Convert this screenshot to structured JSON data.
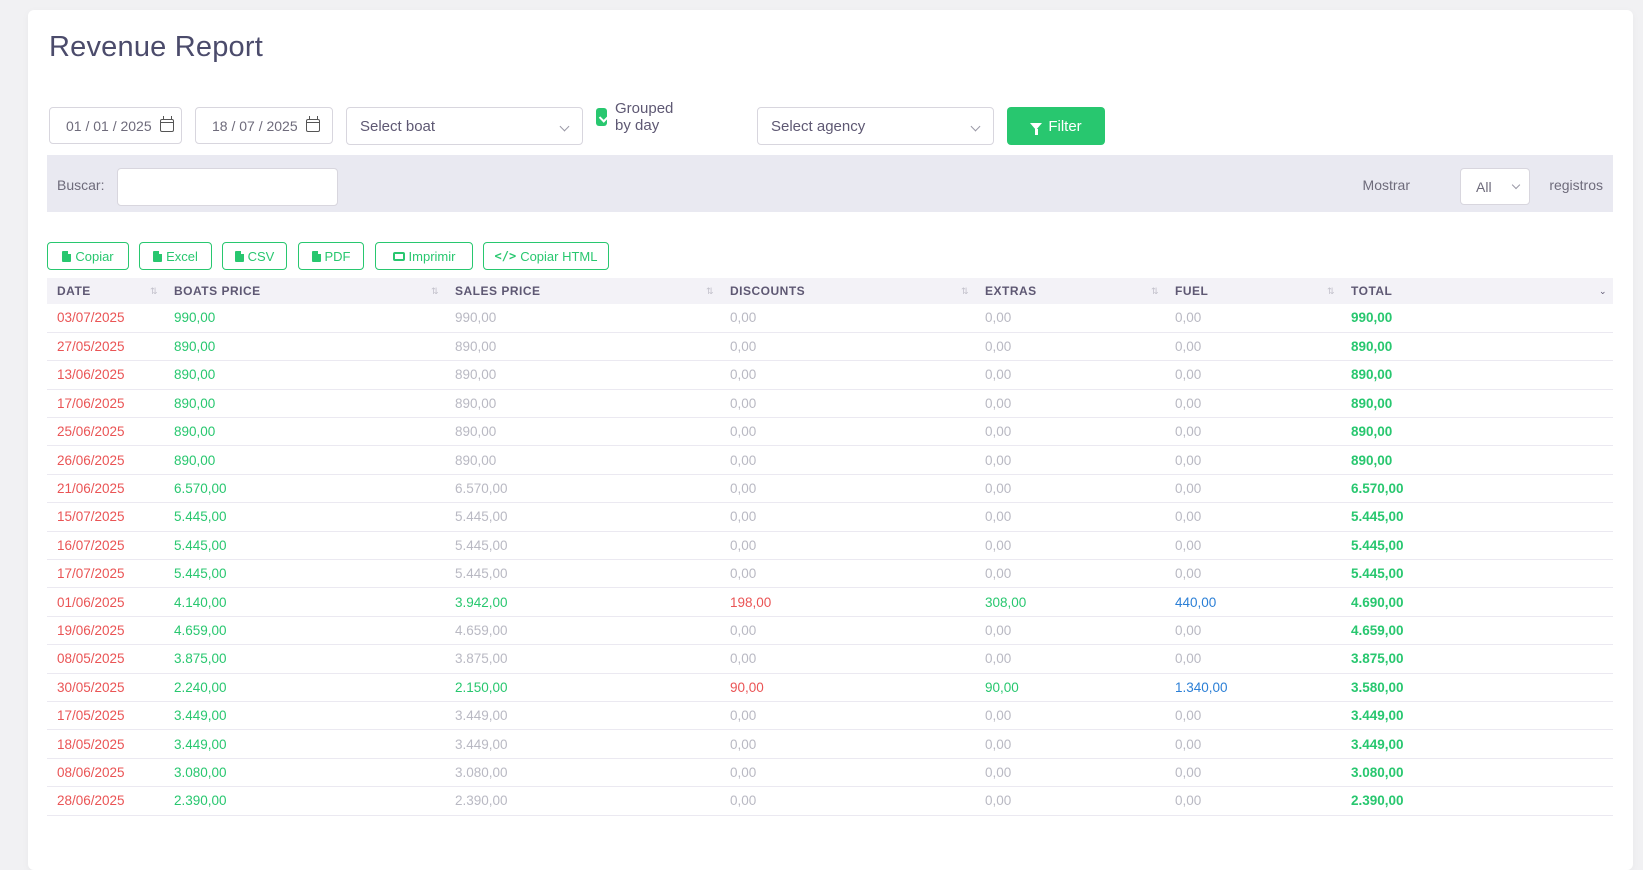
{
  "page": {
    "title": "Revenue Report"
  },
  "filters": {
    "date_from": "01 / 01 / 2025",
    "date_to": "18 / 07 / 2025",
    "boat_select": "Select boat",
    "grouped_label": "Grouped by day",
    "agency_select": "Select agency",
    "filter_button": "Filter"
  },
  "search": {
    "label": "Buscar:",
    "value": ""
  },
  "show": {
    "label": "Mostrar",
    "value": "All",
    "suffix": "registros"
  },
  "export_buttons": [
    "Copiar",
    "Excel",
    "CSV",
    "PDF",
    "Imprimir",
    "Copiar HTML"
  ],
  "table": {
    "headers": [
      "DATE",
      "BOATS PRICE",
      "SALES PRICE",
      "DISCOUNTS",
      "EXTRAS",
      "FUEL",
      "TOTAL"
    ],
    "rows": [
      [
        "03/07/2025",
        "990,00",
        "990,00",
        "0,00",
        "0,00",
        "0,00",
        "990,00"
      ],
      [
        "27/05/2025",
        "890,00",
        "890,00",
        "0,00",
        "0,00",
        "0,00",
        "890,00"
      ],
      [
        "13/06/2025",
        "890,00",
        "890,00",
        "0,00",
        "0,00",
        "0,00",
        "890,00"
      ],
      [
        "17/06/2025",
        "890,00",
        "890,00",
        "0,00",
        "0,00",
        "0,00",
        "890,00"
      ],
      [
        "25/06/2025",
        "890,00",
        "890,00",
        "0,00",
        "0,00",
        "0,00",
        "890,00"
      ],
      [
        "26/06/2025",
        "890,00",
        "890,00",
        "0,00",
        "0,00",
        "0,00",
        "890,00"
      ],
      [
        "21/06/2025",
        "6.570,00",
        "6.570,00",
        "0,00",
        "0,00",
        "0,00",
        "6.570,00"
      ],
      [
        "15/07/2025",
        "5.445,00",
        "5.445,00",
        "0,00",
        "0,00",
        "0,00",
        "5.445,00"
      ],
      [
        "16/07/2025",
        "5.445,00",
        "5.445,00",
        "0,00",
        "0,00",
        "0,00",
        "5.445,00"
      ],
      [
        "17/07/2025",
        "5.445,00",
        "5.445,00",
        "0,00",
        "0,00",
        "0,00",
        "5.445,00"
      ],
      [
        "01/06/2025",
        "4.140,00",
        "3.942,00",
        "198,00",
        "308,00",
        "440,00",
        "4.690,00"
      ],
      [
        "19/06/2025",
        "4.659,00",
        "4.659,00",
        "0,00",
        "0,00",
        "0,00",
        "4.659,00"
      ],
      [
        "08/05/2025",
        "3.875,00",
        "3.875,00",
        "0,00",
        "0,00",
        "0,00",
        "3.875,00"
      ],
      [
        "30/05/2025",
        "2.240,00",
        "2.150,00",
        "90,00",
        "90,00",
        "1.340,00",
        "3.580,00"
      ],
      [
        "17/05/2025",
        "3.449,00",
        "3.449,00",
        "0,00",
        "0,00",
        "0,00",
        "3.449,00"
      ],
      [
        "18/05/2025",
        "3.449,00",
        "3.449,00",
        "0,00",
        "0,00",
        "0,00",
        "3.449,00"
      ],
      [
        "08/06/2025",
        "3.080,00",
        "3.080,00",
        "0,00",
        "0,00",
        "0,00",
        "3.080,00"
      ],
      [
        "28/06/2025",
        "2.390,00",
        "2.390,00",
        "0,00",
        "0,00",
        "0,00",
        "2.390,00"
      ]
    ]
  },
  "colors": {
    "accent": "#28c76f",
    "date": "#ea5455",
    "muted": "#b9b9c3",
    "discount": "#ea5455",
    "fuel": "#2b7fd6"
  }
}
